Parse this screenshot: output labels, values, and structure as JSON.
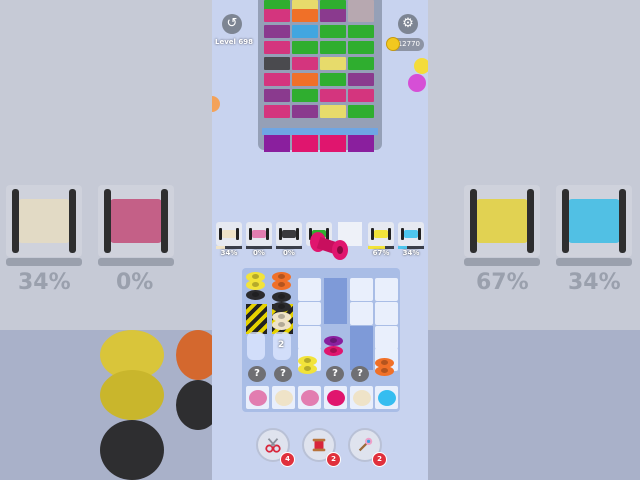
{
  "hud": {
    "level_label": "Level 698",
    "coins": "12770",
    "back_icon": "undo-icon",
    "settings_icon": "gear-icon"
  },
  "spools": [
    {
      "color": "#efe3c8",
      "percent_label": "34%",
      "fill": 0.34
    },
    {
      "color": "#e27db0",
      "percent_label": "0%",
      "fill": 0
    },
    {
      "color": "#3a3a3d",
      "percent_label": "0%",
      "fill": 0
    },
    {
      "color": "#2fae2f",
      "percent_label": "",
      "fill": 0
    },
    {
      "color": "#f2e33a",
      "percent_label": "67%",
      "fill": 0.67
    },
    {
      "color": "#4ec6ee",
      "percent_label": "34%",
      "fill": 0.34
    }
  ],
  "board": {
    "stack_count_label": "2",
    "hidden_label": "?"
  },
  "boosters": [
    {
      "icon": "scissors-icon",
      "count": "4"
    },
    {
      "icon": "thread-spool-icon",
      "count": "2"
    },
    {
      "icon": "magic-wand-icon",
      "count": "2"
    }
  ],
  "background": {
    "left_pct_1": "34%",
    "left_pct_2": "0%",
    "right_pct_1": "67%",
    "right_pct_2": "34%"
  },
  "colors": {
    "pink": "#e0156e",
    "yellow": "#f2e33a",
    "orange": "#f07028",
    "black": "#2b2b2e",
    "cream": "#efe3c8",
    "cyan": "#35bdf0",
    "purple": "#8a1f9e",
    "green": "#2fae2f"
  }
}
